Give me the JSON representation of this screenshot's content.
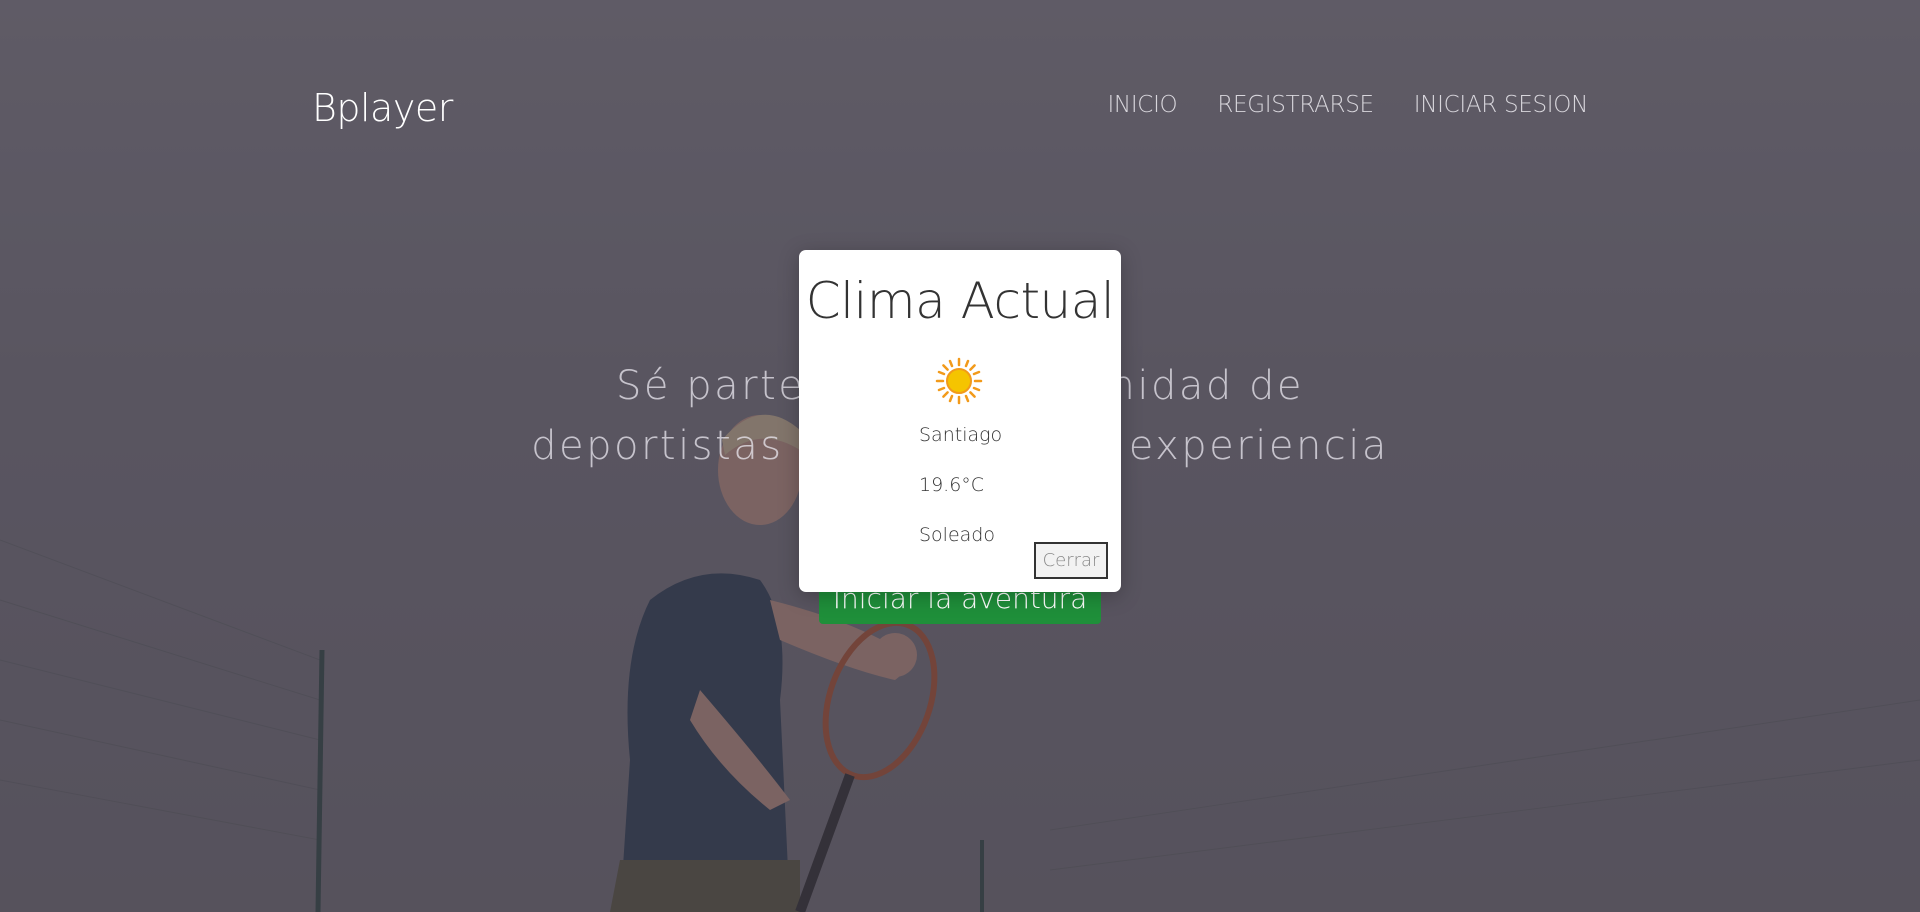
{
  "header": {
    "brand": "Bplayer",
    "nav": [
      {
        "label": "INICIO"
      },
      {
        "label": "REGISTRARSE"
      },
      {
        "label": "INICIAR SESION"
      }
    ]
  },
  "hero": {
    "line1": "Sé parte de una comunidad de",
    "line2": "deportistas y comparte tu experiencia",
    "cta_label": "Iniciar la aventura"
  },
  "weather_modal": {
    "title": "Clima Actual",
    "icon": "sun-icon",
    "city": "Santiago",
    "temperature": "19.6°C",
    "condition": "Soleado",
    "close_label": "Cerrar"
  },
  "colors": {
    "cta_green": "#1f8f3a",
    "sun_yellow": "#f5c400",
    "sun_orange": "#f29a1a"
  }
}
